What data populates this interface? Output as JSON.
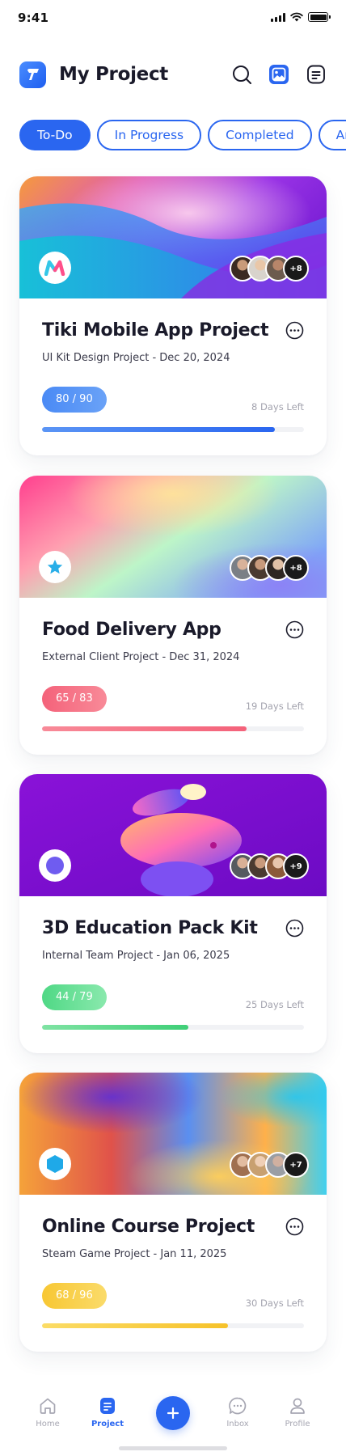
{
  "status_bar": {
    "time": "9:41"
  },
  "header": {
    "title": "My Project"
  },
  "tabs": [
    {
      "label": "To-Do",
      "active": true
    },
    {
      "label": "In Progress",
      "active": false
    },
    {
      "label": "Completed",
      "active": false
    },
    {
      "label": "Archived",
      "active": false
    }
  ],
  "projects": [
    {
      "title": "Tiki Mobile App Project",
      "subtitle": "UI Kit Design Project - Dec 20, 2024",
      "progress_label": "80 / 90",
      "progress": 0.89,
      "days_left": "8 Days Left",
      "extra_members": "+8",
      "accent": "#3a7bf2",
      "logo_icon": "m-logo-icon"
    },
    {
      "title": "Food Delivery App",
      "subtitle": "External Client Project - Dec 31, 2024",
      "progress_label": "65 / 83",
      "progress": 0.78,
      "days_left": "19 Days Left",
      "extra_members": "+8",
      "accent": "#f26b7a",
      "logo_icon": "star-icon"
    },
    {
      "title": "3D Education Pack Kit",
      "subtitle": "Internal Team Project - Jan 06, 2025",
      "progress_label": "44 / 79",
      "progress": 0.56,
      "days_left": "25 Days Left",
      "extra_members": "+9",
      "accent": "#4fd885",
      "logo_icon": "circle-icon"
    },
    {
      "title": "Online Course Project",
      "subtitle": "Steam Game Project - Jan 11, 2025",
      "progress_label": "68 / 96",
      "progress": 0.71,
      "days_left": "30 Days Left",
      "extra_members": "+7",
      "accent": "#f8c733",
      "logo_icon": "hexagon-icon"
    }
  ],
  "bottom_nav": {
    "items": [
      {
        "label": "Home",
        "icon": "home-icon",
        "active": false
      },
      {
        "label": "Project",
        "icon": "document-icon",
        "active": true
      },
      {
        "label": "Inbox",
        "icon": "chat-icon",
        "active": false
      },
      {
        "label": "Profile",
        "icon": "user-icon",
        "active": false
      }
    ],
    "fab_icon": "plus-icon"
  },
  "colors": {
    "primary": "#2a66f0",
    "text": "#1a1a2a",
    "muted": "#a3a3ae"
  }
}
